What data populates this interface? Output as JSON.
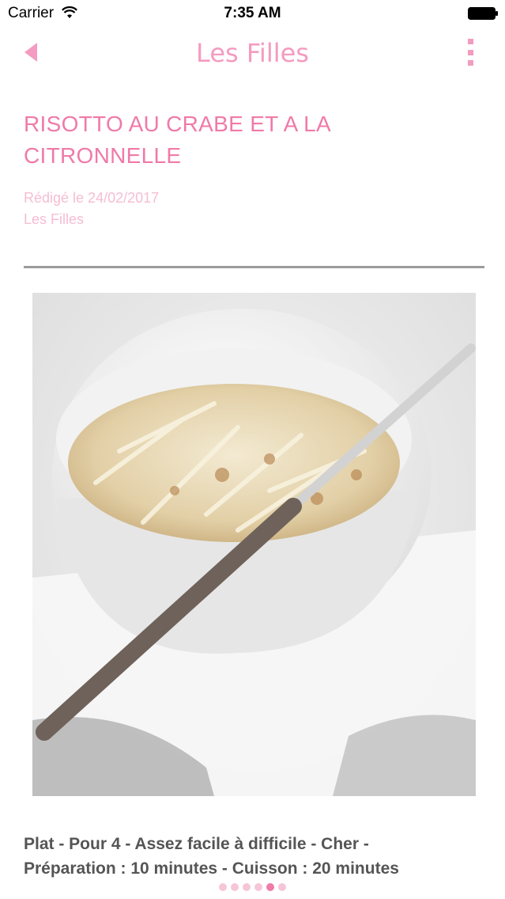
{
  "status_bar": {
    "carrier": "Carrier",
    "time": "7:35 AM",
    "icons": [
      "wifi-icon",
      "battery-icon"
    ]
  },
  "nav": {
    "title": "Les Filles",
    "back_icon": "back-triangle-icon",
    "more_icon": "more-vertical-icon",
    "accent_color": "#f49bc0"
  },
  "article": {
    "title": "RISOTTO AU CRABE ET A LA CITRONNELLE",
    "date": "Rédigé le 24/02/2017",
    "author": "Les Filles",
    "photo_subject": "bowl-of-risotto-image",
    "info_line_1": "Plat - Pour 4 - Assez facile à difficile - Cher -",
    "info_line_2": "Préparation : 10 minutes - Cuisson : 20 minutes"
  },
  "pager": {
    "total": 6,
    "active_index": 4
  }
}
